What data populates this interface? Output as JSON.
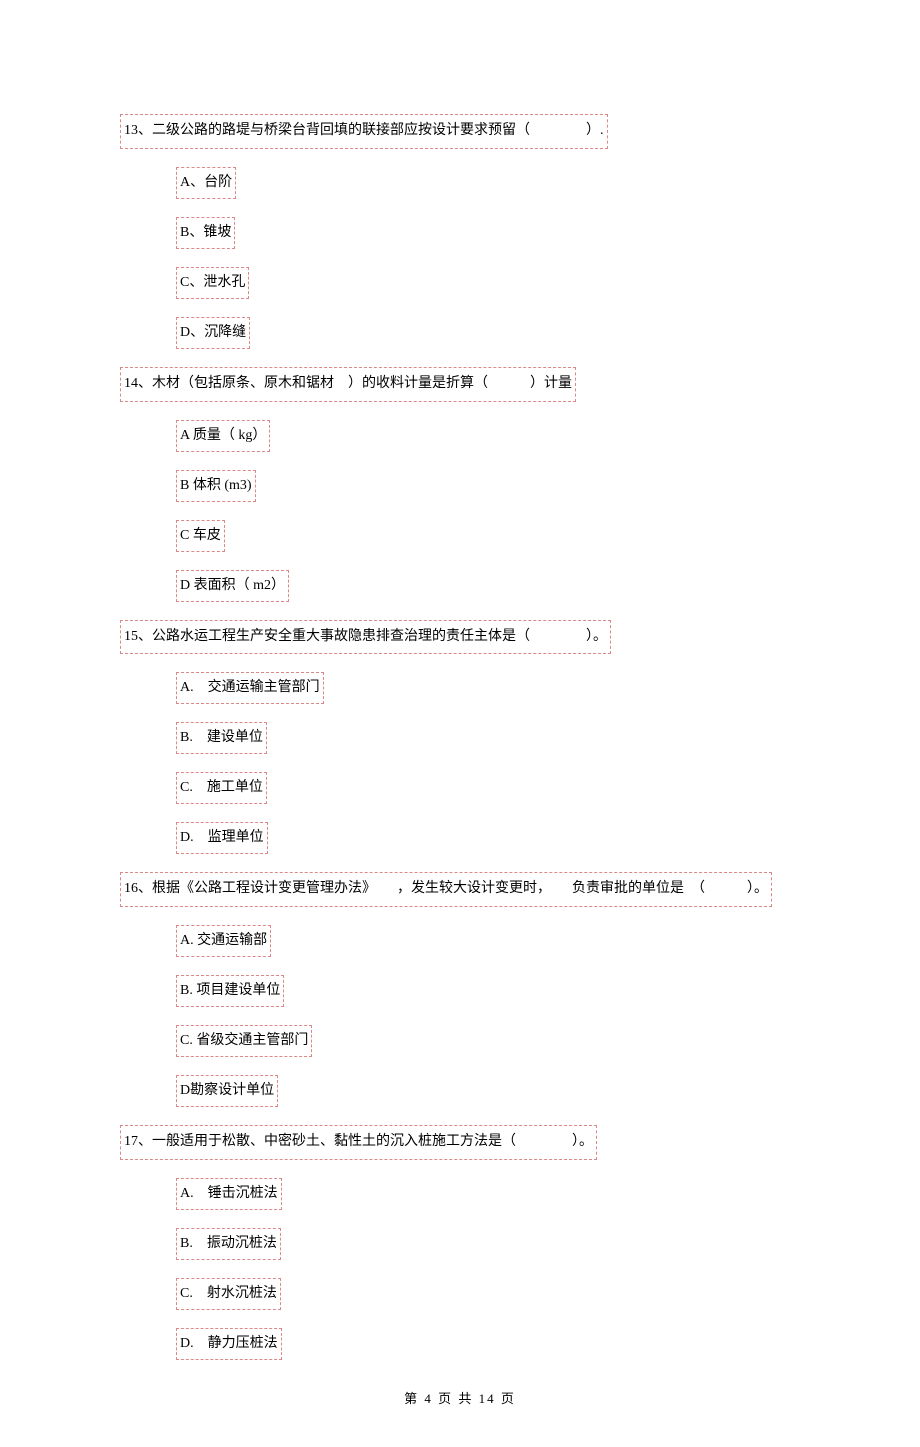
{
  "questions": [
    {
      "num": "13",
      "stem": "13、二级公路的路堤与桥梁台背回填的联接部应按设计要求预留（　　　　）.",
      "options": [
        "A、台阶",
        "B、锥坡",
        "C、泄水孔",
        "D、沉降缝"
      ]
    },
    {
      "num": "14",
      "stem": "14、木材（包括原条、原木和锯材　）的收料计量是折算（　　　）计量",
      "options": [
        "A 质量（ kg）",
        "B 体积 (m3)",
        "C 车皮",
        "D 表面积（ m2）"
      ]
    },
    {
      "num": "15",
      "stem": "15、公路水运工程生产安全重大事故隐患排查治理的责任主体是（　　　　）。",
      "options": [
        "A.　交通运输主管部门",
        "B.　建设单位",
        "C.　施工单位",
        "D.　监理单位"
      ]
    },
    {
      "num": "16",
      "stem": "16、根据《公路工程设计变更管理办法》　　，发生较大设计变更时，　　负责审批的单位是　（　　　）。",
      "options": [
        "A. 交通运输部",
        "B. 项目建设单位",
        "C. 省级交通主管部门",
        "D勘察设计单位"
      ]
    },
    {
      "num": "17",
      "stem": "17、一般适用于松散、中密砂土、黏性土的沉入桩施工方法是（　　　　）。",
      "options": [
        "A.　锤击沉桩法",
        "B.　振动沉桩法",
        "C.　射水沉桩法",
        "D.　静力压桩法"
      ]
    }
  ],
  "footer": {
    "prefix": "第",
    "current": "4",
    "mid": "页 共",
    "total": "14",
    "suffix": "页"
  }
}
